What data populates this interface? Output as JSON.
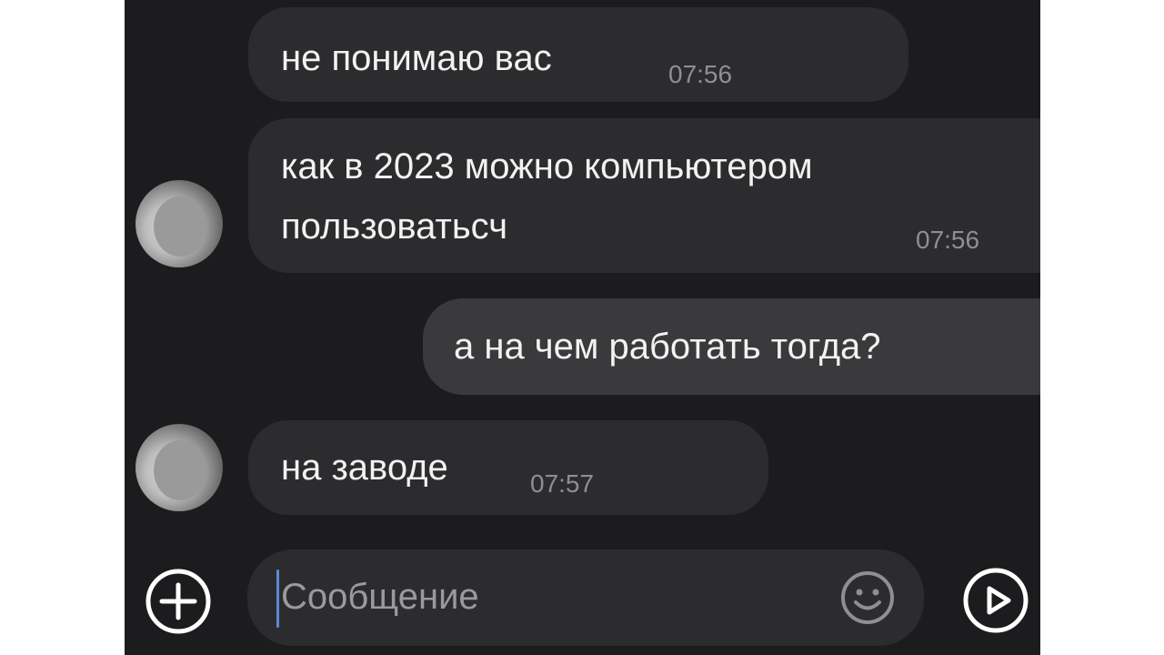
{
  "messages": [
    {
      "direction": "incoming",
      "text": "не понимаю вас",
      "time": "07:56"
    },
    {
      "direction": "incoming",
      "text_line1": "как в 2023 можно компьютером",
      "text_line2": "пользоватьсч",
      "time": "07:56"
    },
    {
      "direction": "outgoing",
      "text": "а на чем работать тогда?"
    },
    {
      "direction": "incoming",
      "text": "на заводе",
      "time": "07:57"
    }
  ],
  "composer": {
    "placeholder": "Сообщение"
  },
  "icons": {
    "attach": "plus-circle-icon",
    "emoji": "smiley-icon",
    "send": "play-circle-icon"
  },
  "colors": {
    "background": "#1c1c1e",
    "bubble": "#2c2c2e",
    "outgoing_bubble": "#3a3a3c",
    "text": "#f2f2f2",
    "timestamp": "#8e8e93",
    "caret": "#5b8bd6"
  }
}
